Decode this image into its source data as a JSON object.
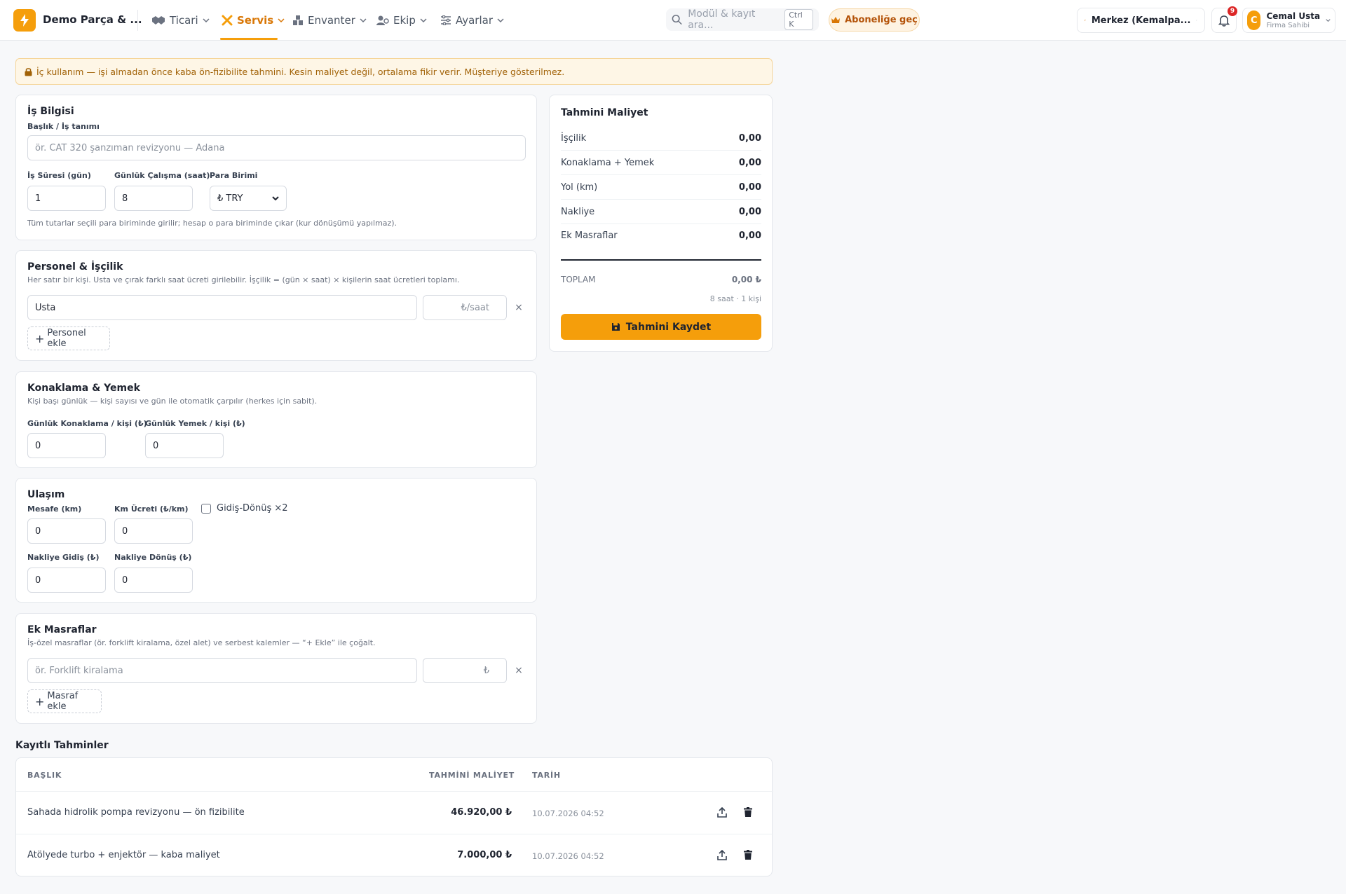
{
  "app": {
    "brand": "Demo Parça & ...",
    "nav": [
      {
        "label": "Ticari",
        "icon": "handshake-icon"
      },
      {
        "label": "Servis",
        "icon": "tools-icon",
        "active": true
      },
      {
        "label": "Envanter",
        "icon": "warehouse-icon"
      },
      {
        "label": "Ekip",
        "icon": "team-icon"
      },
      {
        "label": "Ayarlar",
        "icon": "sliders-icon"
      }
    ],
    "search_placeholder": "Modül & kayıt ara...",
    "search_shortcut": "Ctrl K",
    "subscribe_label": "Aboneliğe geç",
    "branch_label": "Merkez (Kemalpa...",
    "notifications_count": "9",
    "user": {
      "initial": "C",
      "name": "Cemal Usta",
      "role": "Firma Sahibi"
    },
    "accent_color": "#f59e0b"
  },
  "warning_text": "İç kullanım — işi almadan önce kaba ön-fizibilite tahmini. Kesin maliyet değil, ortalama fikir verir. Müşteriye gösterilmez.",
  "job_info": {
    "title": "İş Bilgisi",
    "title_label": "Başlık / İş tanımı",
    "title_placeholder": "ör. CAT 320 şanzıman revizyonu — Adana",
    "duration_label": "İş Süresi (gün)",
    "duration_value": "1",
    "daily_hours_label": "Günlük Çalışma (saat)",
    "daily_hours_value": "8",
    "currency_label": "Para Birimi",
    "currency_value": "₺ TRY",
    "note": "Tüm tutarlar seçili para biriminde girilir; hesap o para biriminde çıkar (kur dönüşümü yapılmaz)."
  },
  "personnel": {
    "title": "Personel & İşçilik",
    "desc": "Her satır bir kişi. Usta ve çırak farklı saat ücreti girilebilir. İşçilik = (gün × saat) × kişilerin saat ücretleri toplamı.",
    "rows": [
      {
        "name": "Usta",
        "rate_placeholder": "₺/saat"
      }
    ],
    "add_label": "Personel ekle"
  },
  "lodging": {
    "title": "Konaklama & Yemek",
    "desc": "Kişi başı günlük — kişi sayısı ve gün ile otomatik çarpılır (herkes için sabit).",
    "lodging_label": "Günlük Konaklama / kişi (₺)",
    "lodging_value": "0",
    "meal_label": "Günlük Yemek / kişi (₺)",
    "meal_value": "0"
  },
  "transport": {
    "title": "Ulaşım",
    "distance_label": "Mesafe (km)",
    "distance_value": "0",
    "km_fee_label": "Km Ücreti (₺/km)",
    "km_fee_value": "0",
    "roundtrip_label": "Gidiş-Dönüş ×2",
    "ship_out_label": "Nakliye Gidiş (₺)",
    "ship_out_value": "0",
    "ship_back_label": "Nakliye Dönüş (₺)",
    "ship_back_value": "0"
  },
  "extra": {
    "title": "Ek Masraflar",
    "desc": "İş-özel masraflar (ör. forklift kiralama, özel alet) ve serbest kalemler — “+ Ekle” ile çoğalt.",
    "rows": [
      {
        "name_placeholder": "ör. Forklift kiralama",
        "amount_placeholder": "₺"
      }
    ],
    "add_label": "Masraf ekle"
  },
  "summary": {
    "title": "Tahmini Maliyet",
    "rows": [
      {
        "label": "İşçilik",
        "value": "0,00"
      },
      {
        "label": "Konaklama + Yemek",
        "value": "0,00"
      },
      {
        "label": "Yol (km)",
        "value": "0,00"
      },
      {
        "label": "Nakliye",
        "value": "0,00"
      },
      {
        "label": "Ek Masraflar",
        "value": "0,00"
      }
    ],
    "total_label": "TOPLAM",
    "total_value": "0,00 ₺",
    "meta": "8 saat · 1 kişi",
    "save_label": "Tahmini Kaydet"
  },
  "saved": {
    "title": "Kayıtlı Tahminler",
    "columns": [
      "BAŞLIK",
      "TAHMİNİ MALİYET",
      "TARİH"
    ],
    "rows": [
      {
        "title": "Sahada hidrolik pompa revizyonu — ön fizibilite",
        "cost": "46.920,00 ₺",
        "date": "10.07.2026 04:52"
      },
      {
        "title": "Atölyede turbo + enjektör — kaba maliyet",
        "cost": "7.000,00 ₺",
        "date": "10.07.2026 04:52"
      }
    ]
  }
}
